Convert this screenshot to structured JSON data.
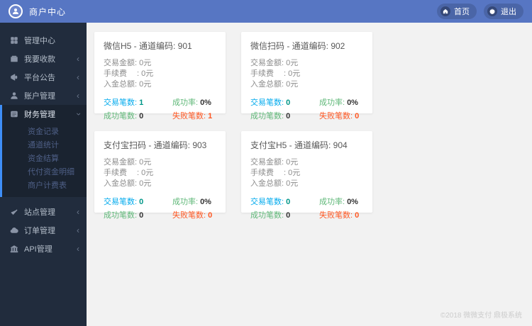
{
  "topbar": {
    "title": "商户中心",
    "home_label": "首页",
    "logout_label": "退出"
  },
  "sidebar": {
    "items": [
      {
        "label": "管理中心",
        "icon": "dashboard-icon"
      },
      {
        "label": "我要收款",
        "icon": "collect-icon"
      },
      {
        "label": "平台公告",
        "icon": "announcement-icon"
      },
      {
        "label": "账户管理",
        "icon": "account-icon"
      },
      {
        "label": "财务管理",
        "icon": "finance-icon",
        "expanded": true,
        "children": [
          "资金记录",
          "通道统计",
          "资金结算",
          "代付资金明细",
          "商户计费表"
        ]
      },
      {
        "label": "站点管理",
        "icon": "check-icon"
      },
      {
        "label": "订单管理",
        "icon": "cloud-icon"
      },
      {
        "label": "API管理",
        "icon": "bank-icon"
      }
    ]
  },
  "card_labels": {
    "amount": "交易金额: ",
    "fee": "手续费　 : ",
    "deposit": "入金总额: ",
    "trade_count": "交易笔数:",
    "success_rate": "成功率:",
    "success_count": "成功笔数:",
    "fail_count": "失败笔数:"
  },
  "cards": [
    {
      "title": "微信H5 - 通道编码: 901",
      "amount": "0元",
      "fee": "0元",
      "deposit": "0元",
      "trade_count": "1",
      "success_rate": "0%",
      "success_count": "0",
      "fail_count": "1"
    },
    {
      "title": "微信扫码 - 通道编码: 902",
      "amount": "0元",
      "fee": "0元",
      "deposit": "0元",
      "trade_count": "0",
      "success_rate": "0%",
      "success_count": "0",
      "fail_count": "0"
    },
    {
      "title": "支付宝扫码 - 通道编码: 903",
      "amount": "0元",
      "fee": "0元",
      "deposit": "0元",
      "trade_count": "0",
      "success_rate": "0%",
      "success_count": "0",
      "fail_count": "0"
    },
    {
      "title": "支付宝H5 - 通道编码: 904",
      "amount": "0元",
      "fee": "0元",
      "deposit": "0元",
      "trade_count": "0",
      "success_rate": "0%",
      "success_count": "0",
      "fail_count": "0"
    }
  ],
  "footer": {
    "copyright": "©2018 微微支付 鼎极系统"
  },
  "colors": {
    "topbar": "#5776c3",
    "sidebar": "#212c3d",
    "submenu_bg": "#1a2330",
    "active_accent": "#3e8ef7",
    "trade_label": "#01aaed",
    "success_label": "#5fb878",
    "fail_label": "#ff5722",
    "trade_value": "#009688",
    "fail_value": "#ff5722",
    "card_bg": "#ffffff",
    "main_bg": "#f2f2f2"
  }
}
